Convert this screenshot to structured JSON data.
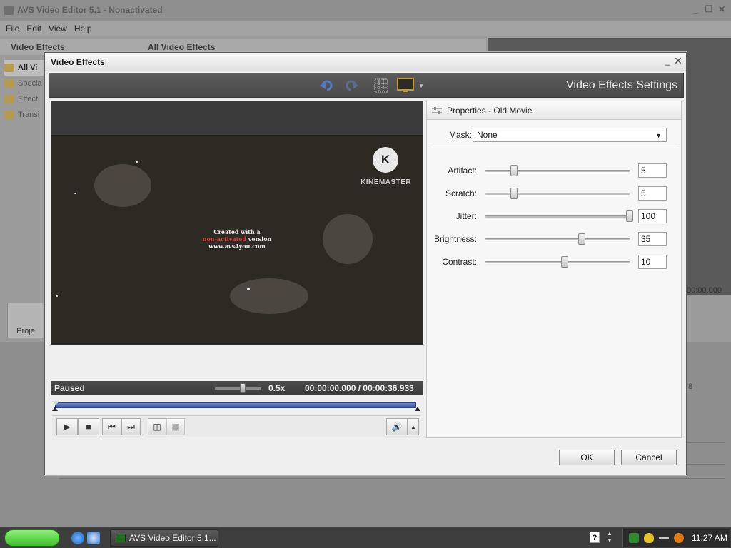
{
  "background_app": {
    "title": "AVS Video Editor 5.1 - Nonactivated",
    "menu": [
      "File",
      "Edit",
      "View",
      "Help"
    ],
    "left_panel_title": "Video Effects",
    "left_items": [
      "All Vi",
      "Specia",
      "Effect",
      "Transi"
    ],
    "center_panel_title": "All Video Effects",
    "time_readout": "00:00.000",
    "projects_label": "Proje",
    "side_number": "8"
  },
  "dialog": {
    "title": "Video Effects",
    "toolbar_title": "Video Effects Settings",
    "preview": {
      "watermark_brand": "KINEMASTER",
      "watermark_line1": "Created with a",
      "watermark_line2_red": "non-activated",
      "watermark_line2_rest": "version",
      "watermark_line3": "www.avs4you.com"
    },
    "playback": {
      "status": "Paused",
      "speed": "0.5x",
      "current_time": "00:00:00.000",
      "time_sep": "/",
      "total_time": "00:00:36.933",
      "speed_level": 0.6
    },
    "properties": {
      "header": "Properties - Old Movie",
      "mask_label": "Mask:",
      "mask_value": "None",
      "params": [
        {
          "label": "Artifact:",
          "value": "5",
          "level": 0.2
        },
        {
          "label": "Scratch:",
          "value": "5",
          "level": 0.2
        },
        {
          "label": "Jitter:",
          "value": "100",
          "level": 1.0
        },
        {
          "label": "Brightness:",
          "value": "35",
          "level": 0.67
        },
        {
          "label": "Contrast:",
          "value": "10",
          "level": 0.55
        }
      ]
    },
    "buttons": {
      "ok": "OK",
      "cancel": "Cancel"
    }
  },
  "taskbar": {
    "task_label": "AVS Video Editor 5.1...",
    "help_glyph": "?",
    "clock": "11:27 AM"
  },
  "colors": {
    "seek_fill": "#3a58a6",
    "toolbar_bg": "#4a4a4a",
    "watermark_red": "#e23c3c",
    "start_button": "#3fbf2a"
  }
}
